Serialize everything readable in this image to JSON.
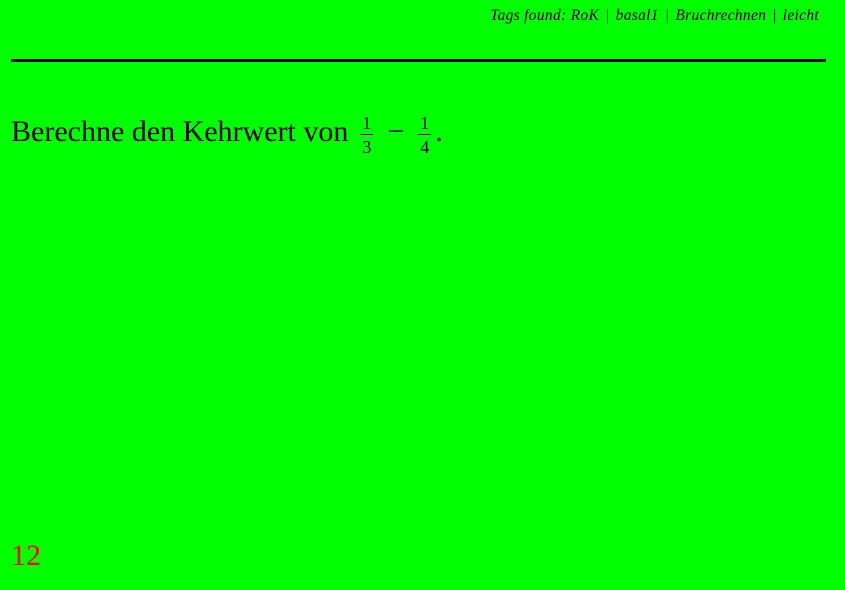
{
  "header": {
    "tags_prefix": "Tags found:",
    "tags": [
      "RoK",
      "basal1",
      "Bruchrechnen",
      "leicht"
    ],
    "separator": "|"
  },
  "question": {
    "text": "Berechne den Kehrwert von",
    "frac1": {
      "num": "1",
      "den": "3"
    },
    "operator": "−",
    "frac2": {
      "num": "1",
      "den": "4"
    },
    "end": "."
  },
  "page_number": "12",
  "colors": {
    "background": "#00ff00",
    "text": "#000000",
    "page_number": "#ff0000"
  }
}
